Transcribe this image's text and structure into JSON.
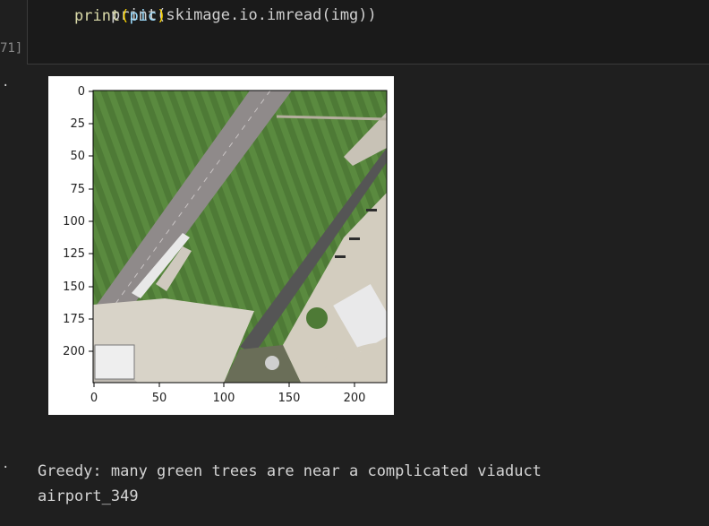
{
  "code_cell": {
    "partial_line": "print(skimage.io.imread(img))",
    "print_fn": "print",
    "print_arg": "pic",
    "open_paren": "(",
    "close_paren": ")",
    "execution_count": "71]"
  },
  "output": {
    "bullet": "·",
    "figure": {
      "y_ticks": [
        "0",
        "25",
        "50",
        "75",
        "100",
        "125",
        "150",
        "175",
        "200"
      ],
      "x_ticks": [
        "0",
        "50",
        "100",
        "150",
        "200"
      ],
      "image_description": "aerial airport"
    },
    "stdout_lines": [
      "Greedy: many green trees are near a complicated viaduct",
      "airport_349"
    ]
  }
}
